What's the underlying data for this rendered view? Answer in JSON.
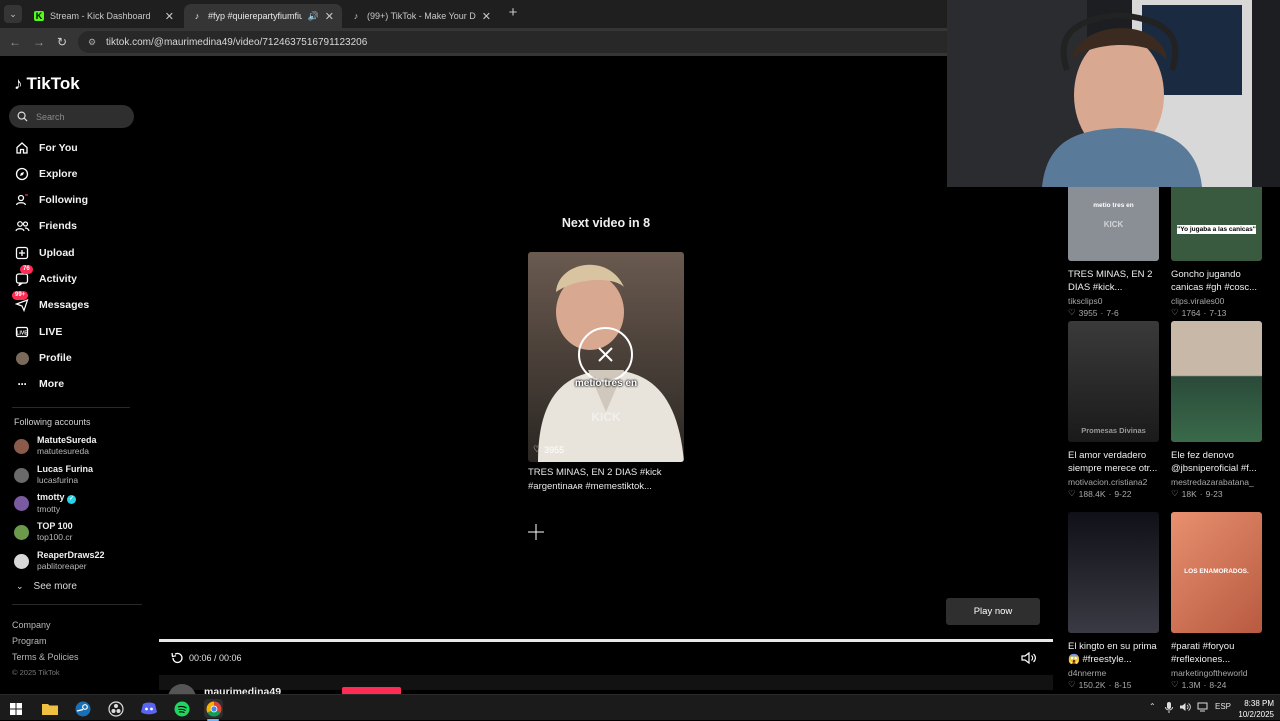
{
  "browser": {
    "tabs": [
      {
        "title": "Stream - Kick Dashboard",
        "icon": "kick-logo"
      },
      {
        "title": "#fyp #quierepartyfiumfium",
        "icon": "tiktok-logo",
        "active": true
      },
      {
        "title": "(99+) TikTok - Make Your Day",
        "icon": "tiktok-logo"
      }
    ],
    "url": "tiktok.com/@maurimedina49/video/7124637516791123206"
  },
  "sidebar": {
    "logo_text": "TikTok",
    "search_placeholder": "Search",
    "nav": [
      {
        "label": "For You",
        "icon": "home-icon"
      },
      {
        "label": "Explore",
        "icon": "compass-icon"
      },
      {
        "label": "Following",
        "icon": "following-icon"
      },
      {
        "label": "Friends",
        "icon": "friends-icon"
      },
      {
        "label": "Upload",
        "icon": "upload-icon"
      },
      {
        "label": "Activity",
        "icon": "activity-icon",
        "badge": "76"
      },
      {
        "label": "Messages",
        "icon": "messages-icon",
        "badge": "99+"
      },
      {
        "label": "LIVE",
        "icon": "live-icon"
      },
      {
        "label": "Profile",
        "icon": "profile-avatar"
      },
      {
        "label": "More",
        "icon": "more-icon"
      }
    ],
    "following_title": "Following accounts",
    "accounts": [
      {
        "name": "MatuteSureda",
        "username": "matutesureda",
        "color": "#8a5a4a"
      },
      {
        "name": "Lucas Furina",
        "username": "lucasfurina",
        "color": "#6a6a6a"
      },
      {
        "name": "tmotty",
        "username": "tmotty",
        "color": "#7a5aa0",
        "verified": true
      },
      {
        "name": "TOP 100",
        "username": "top100.cr",
        "color": "#6a9a4a"
      },
      {
        "name": "ReaperDraws22",
        "username": "pablitoreaper",
        "color": "#d8d8d8"
      }
    ],
    "see_more": "See more",
    "footer": [
      "Company",
      "Program",
      "Terms & Policies"
    ],
    "copyright": "© 2025 TikTok"
  },
  "player": {
    "next_label": "Next video in 8",
    "thumb_caption": "metio tres en",
    "thumb_watermark": "KICK",
    "thumb_likes": "3955",
    "next_description": "TRES MINAS, EN 2 DIAS #kick #argentinaᴀʀ #memestiktok...",
    "play_now": "Play now",
    "time": "00:06 / 00:06",
    "progress": 1.0,
    "author": "maurimedina49"
  },
  "grid": [
    {
      "title": "TRES MINAS, EN 2 DIAS #kick...",
      "user": "tiksclips0",
      "likes": "3955",
      "date": "7-6",
      "overlay": "metio tres en",
      "bg": "#8a8f96"
    },
    {
      "title": "Goncho jugando canicas #gh #cosc...",
      "user": "clips.virales00",
      "likes": "1764",
      "date": "7-13",
      "overlay": "\"Yo jugaba a las canicas\"",
      "bg": "#3a5a40"
    },
    {
      "title": "El amor verdadero siempre merece otr...",
      "user": "motivacion.cristiana2",
      "likes": "188.4K",
      "date": "9-22",
      "overlay": "Promesas Divinas",
      "bg": "#2a2a2a"
    },
    {
      "title": "Ele fez denovo @jbsniperoficial #f...",
      "user": "mestredazarabatana_",
      "likes": "18K",
      "date": "9-23",
      "overlay": "",
      "bg": "#3a5a3a"
    },
    {
      "title": "El kingto en su prima 😱 #freestyle...",
      "user": "d4nnerme",
      "likes": "150.2K",
      "date": "8-15",
      "overlay": "",
      "bg": "#1e2230"
    },
    {
      "title": "#parati #foryou #reflexiones...",
      "user": "marketingoftheworld",
      "likes": "1.3M",
      "date": "8-24",
      "overlay": "LOS ENAMORADOS.",
      "bg": "#d87a5a"
    }
  ],
  "taskbar": {
    "language": "ESP",
    "time": "8:38 PM",
    "date": "10/2/2025"
  }
}
